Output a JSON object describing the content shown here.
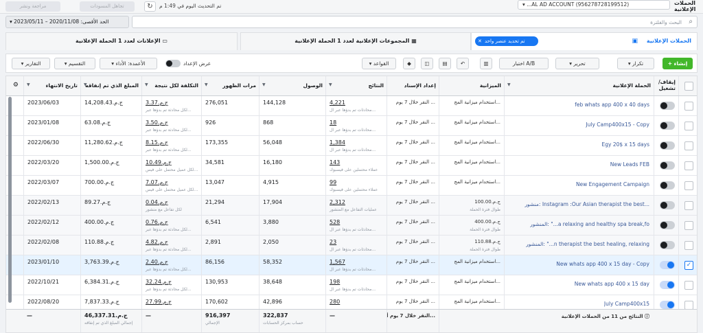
{
  "topbar": {
    "review_label": "مراجعة ونشر",
    "discard_label": "تجاهل المسودات",
    "updated_text": "تم التحديث اليوم في 1:49 م",
    "account": "▾ ...AL AD ACCOUNT (956278728199512)",
    "account_title": "الحملات الإعلانية"
  },
  "filters": {
    "date_range": "▾ 2023/05/11 – 2020/11/08 :الحد الأقصى",
    "search_placeholder": "البحث والفلترة"
  },
  "tabs": {
    "campaigns": "الحملات الإعلانية",
    "chip": "تم تحديد عنصر واحد",
    "adsets": "المجموعات الإعلانية لعدد 1 الحملة الإعلانية",
    "ads": "الإعلانات لعدد 1 الحملة الإعلانية"
  },
  "toolbar": {
    "create": "+ إنشاء",
    "duplicate": "▾ تكرار",
    "edit": "▾ تحرير",
    "ab_test": "اختبار A/B",
    "rules": "▾ القواعد",
    "setup_view": "عرض الإعداد",
    "columns": "▾ الأعمدة: الأداء",
    "breakdown": "▾ التقسيم",
    "reports": "▾ التقارير"
  },
  "columns": {
    "toggle": "إيقاف/ تشغيل",
    "campaign": "الحملة الإعلانية",
    "budget": "الميزانية",
    "attribution": "إعداد الإسناد",
    "results": "النتائج",
    "reach": "الوصول",
    "impressions": "مرات الظهور",
    "cost_per_result": "التكلفة لكل نتيجة",
    "amount_spent": "المبلغ الذي تم إنفاقه",
    "ends": "تاريخ الانتهاء"
  },
  "rows": [
    {
      "on": false,
      "selected": false,
      "name": "feb whats app 400 x 40 days",
      "budget": "استخدام ميزانية المج...",
      "budget_sub": "",
      "attr": "النقر خلال 7 يوم ...",
      "results": "4,221",
      "results_sub": "محادثات تم بدؤها عبر ال...",
      "reach": "144,128",
      "impr": "276,051",
      "cpr": "ج.م.3.37",
      "cpr_sub": "لكل محادثة تم بدؤها عبر...",
      "spent": "ج.م.14,208.43",
      "ends": "2023/06/03"
    },
    {
      "on": false,
      "selected": false,
      "name": "July Camp400x15 - Copy",
      "budget": "استخدام ميزانية المج...",
      "budget_sub": "",
      "attr": "النقر خلال 7 يوم ...",
      "results": "18",
      "results_sub": "محادثات تم بدؤها عبر ال...",
      "reach": "868",
      "impr": "926",
      "cpr": "ج.م.3.50",
      "cpr_sub": "لكل محادثة تم بدؤها عبر...",
      "spent": "ج.م.63.08",
      "ends": "2023/01/08"
    },
    {
      "on": false,
      "selected": false,
      "name": "Egy 20$ x 15 days",
      "budget": "استخدام ميزانية المج...",
      "budget_sub": "",
      "attr": "النقر خلال 7 يوم ...",
      "results": "1,384",
      "results_sub": "محادثات تم بدؤها عبر ال...",
      "reach": "56,048",
      "impr": "173,355",
      "cpr": "ج.م.8.15",
      "cpr_sub": "لكل محادثة تم بدؤها عبر...",
      "spent": "ج.م.11,280.62",
      "ends": "2022/06/30"
    },
    {
      "on": false,
      "selected": false,
      "name": "New Leads FEB",
      "budget": "استخدام ميزانية المج...",
      "budget_sub": "",
      "attr": "النقر خلال 7 يوم ...",
      "results": "143",
      "results_sub": "عملاء محتملين على فيسبوك",
      "reach": "16,180",
      "impr": "34,581",
      "cpr": "ج.م.10.49",
      "cpr_sub": "لكل عميل محتمل على فيس...",
      "spent": "ج.م.1,500.00",
      "ends": "2022/03/20"
    },
    {
      "on": false,
      "selected": false,
      "name": "New Engagement Campaign",
      "budget": "استخدام ميزانية المج...",
      "budget_sub": "",
      "attr": "النقر خلال 7 يوم ...",
      "results": "99",
      "results_sub": "عملاء محتملين على فيسبوك",
      "reach": "4,915",
      "impr": "13,047",
      "cpr": "ج.م.7.07",
      "cpr_sub": "لكل عميل محتمل على فيس...",
      "spent": "ج.م.700.00",
      "ends": "2022/03/07"
    },
    {
      "on": false,
      "selected": false,
      "name": "منشور: Instagram :Our Asian therapist the best...",
      "budget": "ج.م.100.00",
      "budget_sub": "طوال فترة الحملة",
      "attr": "النقر خلال 7 يوم ...",
      "results": "2,312",
      "results_sub": "عمليات التفاعل مع المنشور",
      "reach": "17,904",
      "impr": "21,294",
      "cpr": "ج.م.0.04",
      "cpr_sub": "لكل تفاعل مع منشور",
      "spent": "ج.م.89.27",
      "ends": "2022/02/13"
    },
    {
      "on": false,
      "selected": false,
      "name": "المنشور: \"...a relaxing and healthy spa break,fo",
      "budget": "ج.م.400.00",
      "budget_sub": "طوال فترة الحملة",
      "attr": "النقر خلال 7 يوم ...",
      "results": "528",
      "results_sub": "محادثات تم بدؤها عبر ال...",
      "reach": "3,880",
      "impr": "6,541",
      "cpr": "ج.م.0.76",
      "cpr_sub": "لكل محادثة تم بدؤها عبر...",
      "spent": "ج.م.400.00",
      "ends": "2022/02/12"
    },
    {
      "on": false,
      "selected": false,
      "name": "المنشور: \"...n therapist the best healing, relaxing",
      "budget": "ج.م.110.88",
      "budget_sub": "طوال فترة الحملة",
      "attr": "النقر خلال 7 يوم ...",
      "results": "23",
      "results_sub": "محادثات تم بدؤها عبر ال...",
      "reach": "2,050",
      "impr": "2,891",
      "cpr": "ج.م.4.82",
      "cpr_sub": "لكل محادثة تم بدؤها عبر...",
      "spent": "ج.م.110.88",
      "ends": "2022/02/08"
    },
    {
      "on": true,
      "selected": true,
      "name": "New whats app 400 x 15 day - Copy",
      "budget": "استخدام ميزانية المج...",
      "budget_sub": "",
      "attr": "النقر خلال 7 يوم ...",
      "results": "1,567",
      "results_sub": "محادثات تم بدؤها عبر ال...",
      "reach": "58,352",
      "impr": "86,156",
      "cpr": "ج.م.2.40",
      "cpr_sub": "لكل محادثة تم بدؤها عبر...",
      "spent": "ج.م.3,763.39",
      "ends": "2023/01/10"
    },
    {
      "on": true,
      "selected": false,
      "name": "New whats app 400 x 15 day",
      "budget": "استخدام ميزانية المج...",
      "budget_sub": "",
      "attr": "النقر خلال 7 يوم ...",
      "results": "198",
      "results_sub": "محادثات تم بدؤها عبر ال...",
      "reach": "38,648",
      "impr": "130,953",
      "cpr": "ج.م.32.24",
      "cpr_sub": "لكل محادثة تم بدؤها عبر...",
      "spent": "ج.م.6,384.31",
      "ends": "2022/10/21"
    },
    {
      "on": true,
      "selected": false,
      "name": "July Camp400x15",
      "budget": "استخدام ميزانية المج...",
      "budget_sub": "",
      "attr": "النقر خلال 7 يوم ...",
      "results": "280",
      "results_sub": "",
      "reach": "42,896",
      "impr": "170,602",
      "cpr": "ج.م.27.99",
      "cpr_sub": "",
      "spent": "ج.م.7,837.33",
      "ends": "2022/08/20"
    }
  ],
  "footer": {
    "label": "النتائج من 11 من الحملات الإعلانية",
    "attr": "النقر خلال 7 يوم أ...",
    "results": "—",
    "reach": "322,837",
    "reach_sub": "حساب بمركز الحسابات",
    "impr": "916,397",
    "impr_sub": "الإجمالي",
    "cpr": "—",
    "spent": "ج.م.46,337.31",
    "spent_sub": "إجمالي المبلغ الذي تم إنفاقه",
    "ends": "—"
  }
}
